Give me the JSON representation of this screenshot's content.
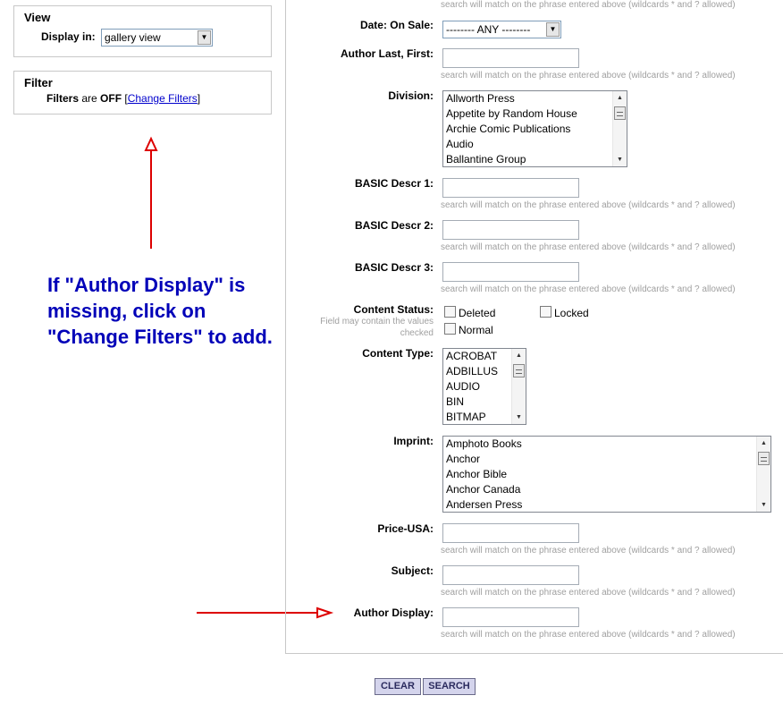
{
  "view": {
    "title": "View",
    "display_label": "Display in:",
    "display_value": "gallery view"
  },
  "filter": {
    "title": "Filter",
    "status_prefix": "Filters",
    "status_middle": " are ",
    "status_value": "OFF",
    "bracket_open": " [",
    "change_link": "Change Filters",
    "bracket_close": "]"
  },
  "annotation": "If \"Author Display\" is missing, click on \"Change Filters\" to add.",
  "hint_text": "search will match on the phrase entered above (wildcards * and ? allowed)",
  "form": {
    "date_on_sale": {
      "label": "Date: On Sale:",
      "value": "-------- ANY --------"
    },
    "author_last_first": {
      "label": "Author Last, First:"
    },
    "division": {
      "label": "Division:",
      "options": [
        "Allworth Press",
        "Appetite by Random House",
        "Archie Comic Publications",
        "Audio",
        "Ballantine Group"
      ]
    },
    "basic_descr_1": {
      "label": "BASIC Descr 1:"
    },
    "basic_descr_2": {
      "label": "BASIC Descr 2:"
    },
    "basic_descr_3": {
      "label": "BASIC Descr 3:"
    },
    "content_status": {
      "label": "Content Status:",
      "sublabel_1": "Field may contain the values",
      "sublabel_2": "checked",
      "options": [
        "Deleted",
        "Locked",
        "Normal"
      ]
    },
    "content_type": {
      "label": "Content Type:",
      "options": [
        "ACROBAT",
        "ADBILLUS",
        "AUDIO",
        "BIN",
        "BITMAP"
      ]
    },
    "imprint": {
      "label": "Imprint:",
      "options": [
        "Amphoto Books",
        "Anchor",
        "Anchor Bible",
        "Anchor Canada",
        "Andersen Press"
      ]
    },
    "price_usa": {
      "label": "Price-USA:"
    },
    "subject": {
      "label": "Subject:"
    },
    "author_display": {
      "label": "Author Display:"
    }
  },
  "buttons": {
    "clear": "CLEAR",
    "search": "SEARCH"
  },
  "colors": {
    "annotation": "#0000b8",
    "arrow": "#dd0000",
    "link": "#0000cc",
    "button_bg": "#d4d4ec"
  }
}
